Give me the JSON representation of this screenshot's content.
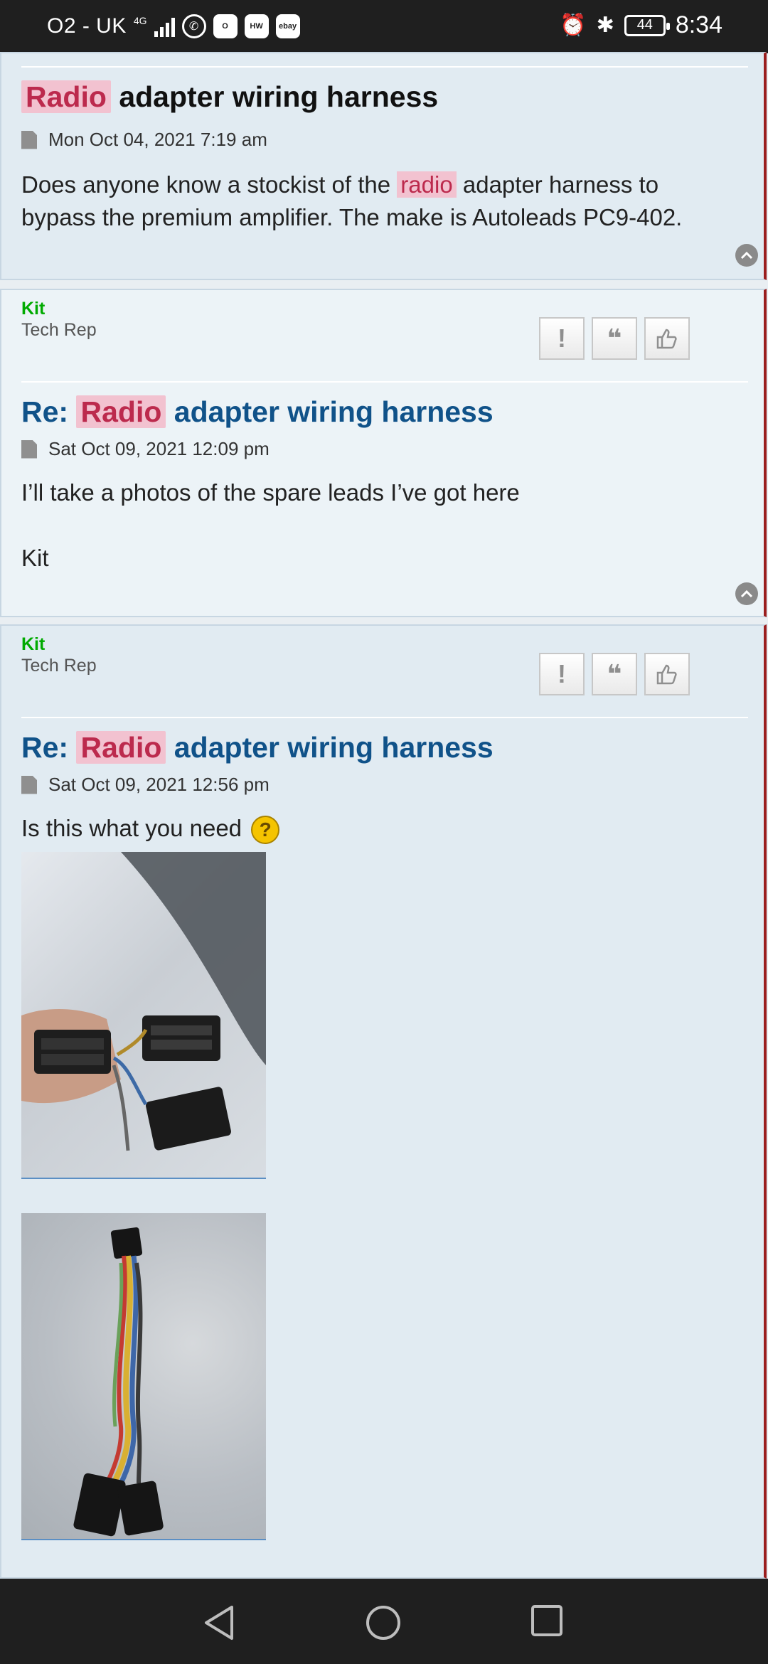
{
  "status_bar": {
    "carrier": "O2 - UK",
    "network": "4G",
    "apps": [
      "whatsapp",
      "outlook",
      "huawei",
      "ebay"
    ],
    "battery": "44",
    "time": "8:34"
  },
  "posts": [
    {
      "title_highlight": "Radio",
      "title_rest": "adapter wiring harness",
      "date": "Mon Oct 04, 2021 7:19 am",
      "body_before": "Does anyone know a stockist of the",
      "body_highlight": "radio",
      "body_after": "adapter harness to bypass the premium amplifier. The make is Autoleads PC9-402."
    },
    {
      "author": "Kit",
      "rank": "Tech Rep",
      "title_prefix": "Re:",
      "title_highlight": "Radio",
      "title_rest": "adapter wiring harness",
      "date": "Sat Oct 09, 2021 12:09 pm",
      "body_line1": "I’ll take a photos of the spare leads I’ve got here",
      "body_line2": "Kit"
    },
    {
      "author": "Kit",
      "rank": "Tech Rep",
      "title_prefix": "Re:",
      "title_highlight": "Radio",
      "title_rest": "adapter wiring harness",
      "date": "Sat Oct 09, 2021 12:56 pm",
      "body_text": "Is this what you need",
      "smiley": "?"
    }
  ],
  "buttons": {
    "report": "!",
    "quote": "❝",
    "like": "👍"
  },
  "colors": {
    "accent_red": "#9b1e1e",
    "highlight_bg": "#f2c2d0",
    "highlight_text": "#bc2a4d",
    "reply_title": "#105289",
    "author": "#00aa00"
  }
}
